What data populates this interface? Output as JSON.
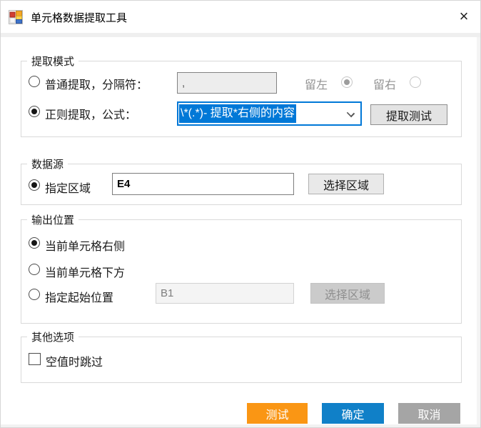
{
  "window": {
    "title": "单元格数据提取工具",
    "close_icon": "×"
  },
  "extract_mode": {
    "title": "提取模式",
    "normal_label": "普通提取，分隔符：",
    "separator_value": ",",
    "keep_left_label": "留左",
    "keep_left_selected": true,
    "keep_right_label": "留右",
    "keep_right_selected": false,
    "normal_selected": false,
    "regex_label": "正则提取，公式：",
    "regex_selected": true,
    "formula_value": "\\*(.*)- 提取*右侧的内容",
    "formula_text_highlighted": true,
    "extract_test_button": "提取测试"
  },
  "data_source": {
    "title": "数据源",
    "area_label": "指定区域",
    "area_selected": true,
    "range_value": "E4",
    "select_area_button": "选择区域"
  },
  "output_position": {
    "title": "输出位置",
    "options": [
      {
        "label": "当前单元格右侧",
        "selected": true
      },
      {
        "label": "当前单元格下方",
        "selected": false
      },
      {
        "label": "指定起始位置",
        "selected": false
      }
    ],
    "start_cell_value": "B1",
    "start_cell_enabled": false,
    "select_area_button": "选择区域",
    "select_area_enabled": false
  },
  "other_options": {
    "title": "其他选项",
    "skip_empty_label": "空值时跳过",
    "skip_empty_checked": false
  },
  "footer": {
    "test_button": "测试",
    "ok_button": "确定",
    "cancel_button": "取消"
  },
  "colors": {
    "button_orange": "#fa9614",
    "button_blue": "#1080c8",
    "button_gray": "#a5a5a5",
    "selection_blue": "#0078d7",
    "focus_border_blue": "#0078d7"
  }
}
